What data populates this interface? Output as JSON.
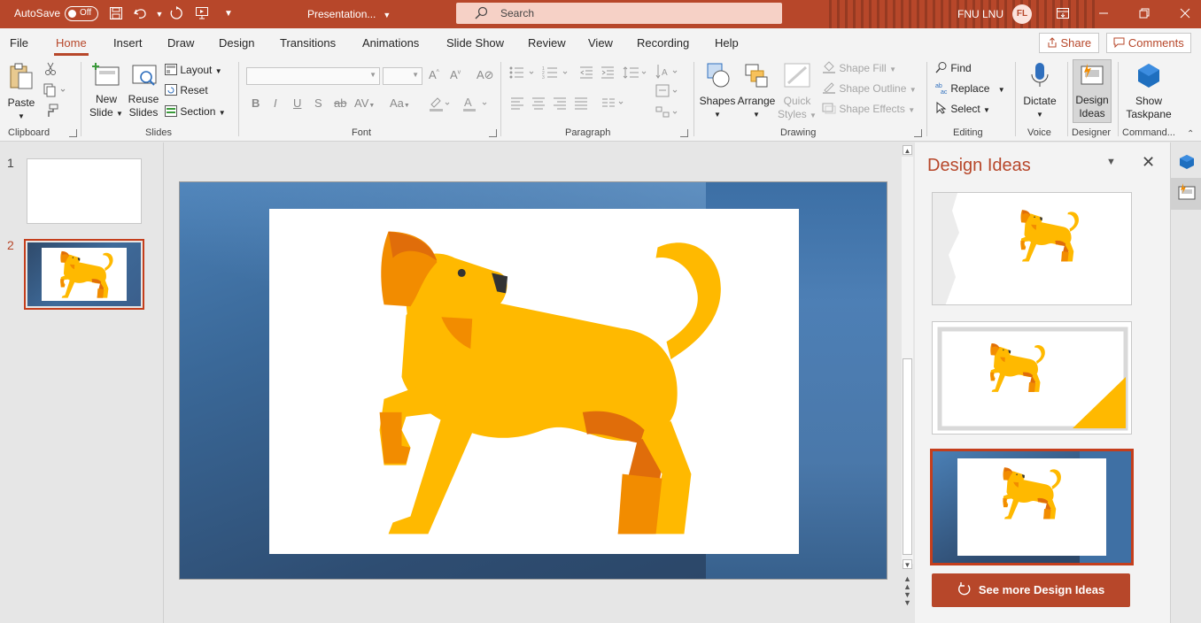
{
  "titlebar": {
    "autosave_label": "AutoSave",
    "autosave_state": "Off",
    "filename": "Presentation...",
    "search_placeholder": "Search",
    "user_name": "FNU LNU",
    "user_initials": "FL"
  },
  "tabs": [
    "File",
    "Home",
    "Insert",
    "Draw",
    "Design",
    "Transitions",
    "Animations",
    "Slide Show",
    "Review",
    "View",
    "Recording",
    "Help"
  ],
  "active_tab": "Home",
  "share_label": "Share",
  "comments_label": "Comments",
  "ribbon": {
    "clipboard": {
      "paste": "Paste",
      "label": "Clipboard"
    },
    "slides": {
      "new_slide_1": "New",
      "new_slide_2": "Slide",
      "reuse_1": "Reuse",
      "reuse_2": "Slides",
      "layout": "Layout",
      "reset": "Reset",
      "section": "Section",
      "label": "Slides"
    },
    "font": {
      "label": "Font"
    },
    "paragraph": {
      "label": "Paragraph"
    },
    "drawing": {
      "shapes": "Shapes",
      "arrange": "Arrange",
      "quick_1": "Quick",
      "quick_2": "Styles",
      "shape_fill": "Shape Fill",
      "shape_outline": "Shape Outline",
      "shape_effects": "Shape Effects",
      "label": "Drawing"
    },
    "editing": {
      "find": "Find",
      "replace": "Replace",
      "select": "Select",
      "label": "Editing"
    },
    "voice": {
      "dictate": "Dictate",
      "label": "Voice"
    },
    "designer": {
      "design_1": "Design",
      "design_2": "Ideas",
      "label": "Designer"
    },
    "commands": {
      "show_1": "Show",
      "show_2": "Taskpane",
      "label": "Command..."
    }
  },
  "thumbnails": {
    "n1": "1",
    "n2": "2"
  },
  "design_pane": {
    "title": "Design Ideas",
    "see_more": "See more Design Ideas"
  },
  "colors": {
    "accent": "#b7472a",
    "dog_yellow": "#ffb900",
    "dog_orange": "#f28c00",
    "dog_dark": "#e05a0a"
  }
}
